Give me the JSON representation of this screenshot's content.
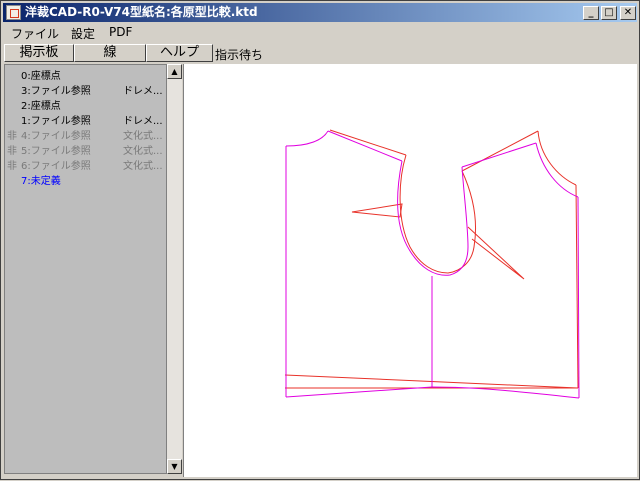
{
  "window": {
    "title": "洋裁CAD-R0-V74型紙名:各原型比較.ktd",
    "minimize_label": "_",
    "maximize_label": "□",
    "close_label": "✕"
  },
  "menu": [
    {
      "label": "ファイル"
    },
    {
      "label": "設定"
    },
    {
      "label": "PDF"
    }
  ],
  "toolbar": {
    "buttons": [
      {
        "label": "掲示板"
      },
      {
        "label": "線"
      },
      {
        "label": "ヘルプ"
      }
    ],
    "status": "指示待ち"
  },
  "layers": [
    {
      "prefix": "",
      "name": "0:座標点",
      "type": "",
      "color": "#000000"
    },
    {
      "prefix": "",
      "name": "3:ファイル参照",
      "type": "ドレメ...",
      "color": "#000000"
    },
    {
      "prefix": "",
      "name": "2:座標点",
      "type": "",
      "color": "#000000"
    },
    {
      "prefix": "",
      "name": "1:ファイル参照",
      "type": "ドレメ...",
      "color": "#000000"
    },
    {
      "prefix": "非",
      "name": "4:ファイル参照",
      "type": "文化式...",
      "color": "#7a7a7a"
    },
    {
      "prefix": "非",
      "name": "5:ファイル参照",
      "type": "文化式...",
      "color": "#7a7a7a"
    },
    {
      "prefix": "非",
      "name": "6:ファイル参照",
      "type": "文化式...",
      "color": "#7a7a7a"
    },
    {
      "prefix": "",
      "name": "7:未定義",
      "type": "",
      "color": "#0000ff"
    }
  ],
  "scrollbar": {
    "up_icon": "triangle-up",
    "down_icon": "triangle-down"
  },
  "pattern_colors": {
    "red": "#e8322a",
    "magenta": "#e000e0"
  }
}
